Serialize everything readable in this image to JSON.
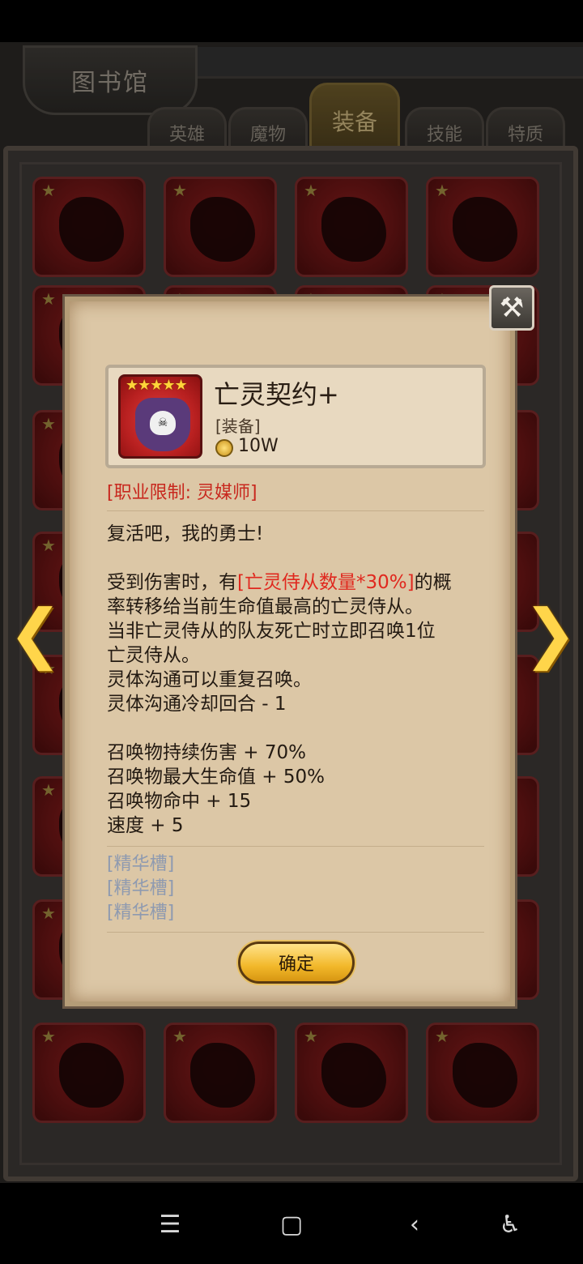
{
  "library": {
    "title": "图书馆",
    "tabs": [
      {
        "label": "英雄"
      },
      {
        "label": "魔物"
      },
      {
        "label": "装备"
      },
      {
        "label": "技能"
      },
      {
        "label": "特质"
      }
    ],
    "active_tab": "装备"
  },
  "icons": {
    "star": "★",
    "close": "⚒",
    "prev": "❮",
    "next": "❯",
    "item_stars": "★★★★★",
    "skull": "☠"
  },
  "popup": {
    "item_name": "亡灵契约+",
    "category": "[装备]",
    "price": "10W",
    "restriction": "[职业限制: 灵媒师]",
    "flavor": "复活吧，我的勇士!",
    "effect_parts": {
      "p1": "受到伤害时，有",
      "highlight": "[亡灵侍从数量*30%]",
      "p2": "的概",
      "l2": "率转移给当前生命值最高的亡灵侍从。",
      "l3": "当非亡灵侍从的队友死亡时立即召唤1位",
      "l4": "亡灵侍从。",
      "l5": "灵体沟通可以重复召唤。",
      "l6": "灵体沟通冷却回合 - 1"
    },
    "stats": [
      "召唤物持续伤害 + 70%",
      "召唤物最大生命值 + 50%",
      "召唤物命中 + 15",
      "速度 + 5"
    ],
    "slots": [
      "[精华槽]",
      "[精华槽]",
      "[精华槽]"
    ],
    "confirm_label": "确定"
  },
  "navbar": {
    "menu": "☰",
    "home": "▢",
    "back": "‹",
    "accessibility": "♿"
  }
}
